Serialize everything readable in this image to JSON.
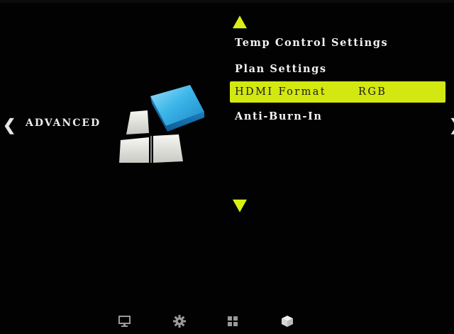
{
  "navigation": {
    "left_arrow": "❮",
    "right_arrow": "❯",
    "category": "ADVANCED"
  },
  "menu": {
    "items": [
      {
        "label": "Temp Control Settings",
        "value": ""
      },
      {
        "label": "Plan Settings",
        "value": ""
      },
      {
        "label": "HDMI Format",
        "value": "RGB",
        "selected": true
      },
      {
        "label": "Anti-Burn-In",
        "value": ""
      }
    ]
  },
  "colors": {
    "highlight": "#d3e810",
    "arrow": "#d9ee14",
    "icon_blue": "#2aa6dd",
    "background": "#000000"
  },
  "dock": {
    "icons": [
      "monitor-icon",
      "gear-icon",
      "grid-icon",
      "box-icon"
    ],
    "active": "box-icon"
  }
}
